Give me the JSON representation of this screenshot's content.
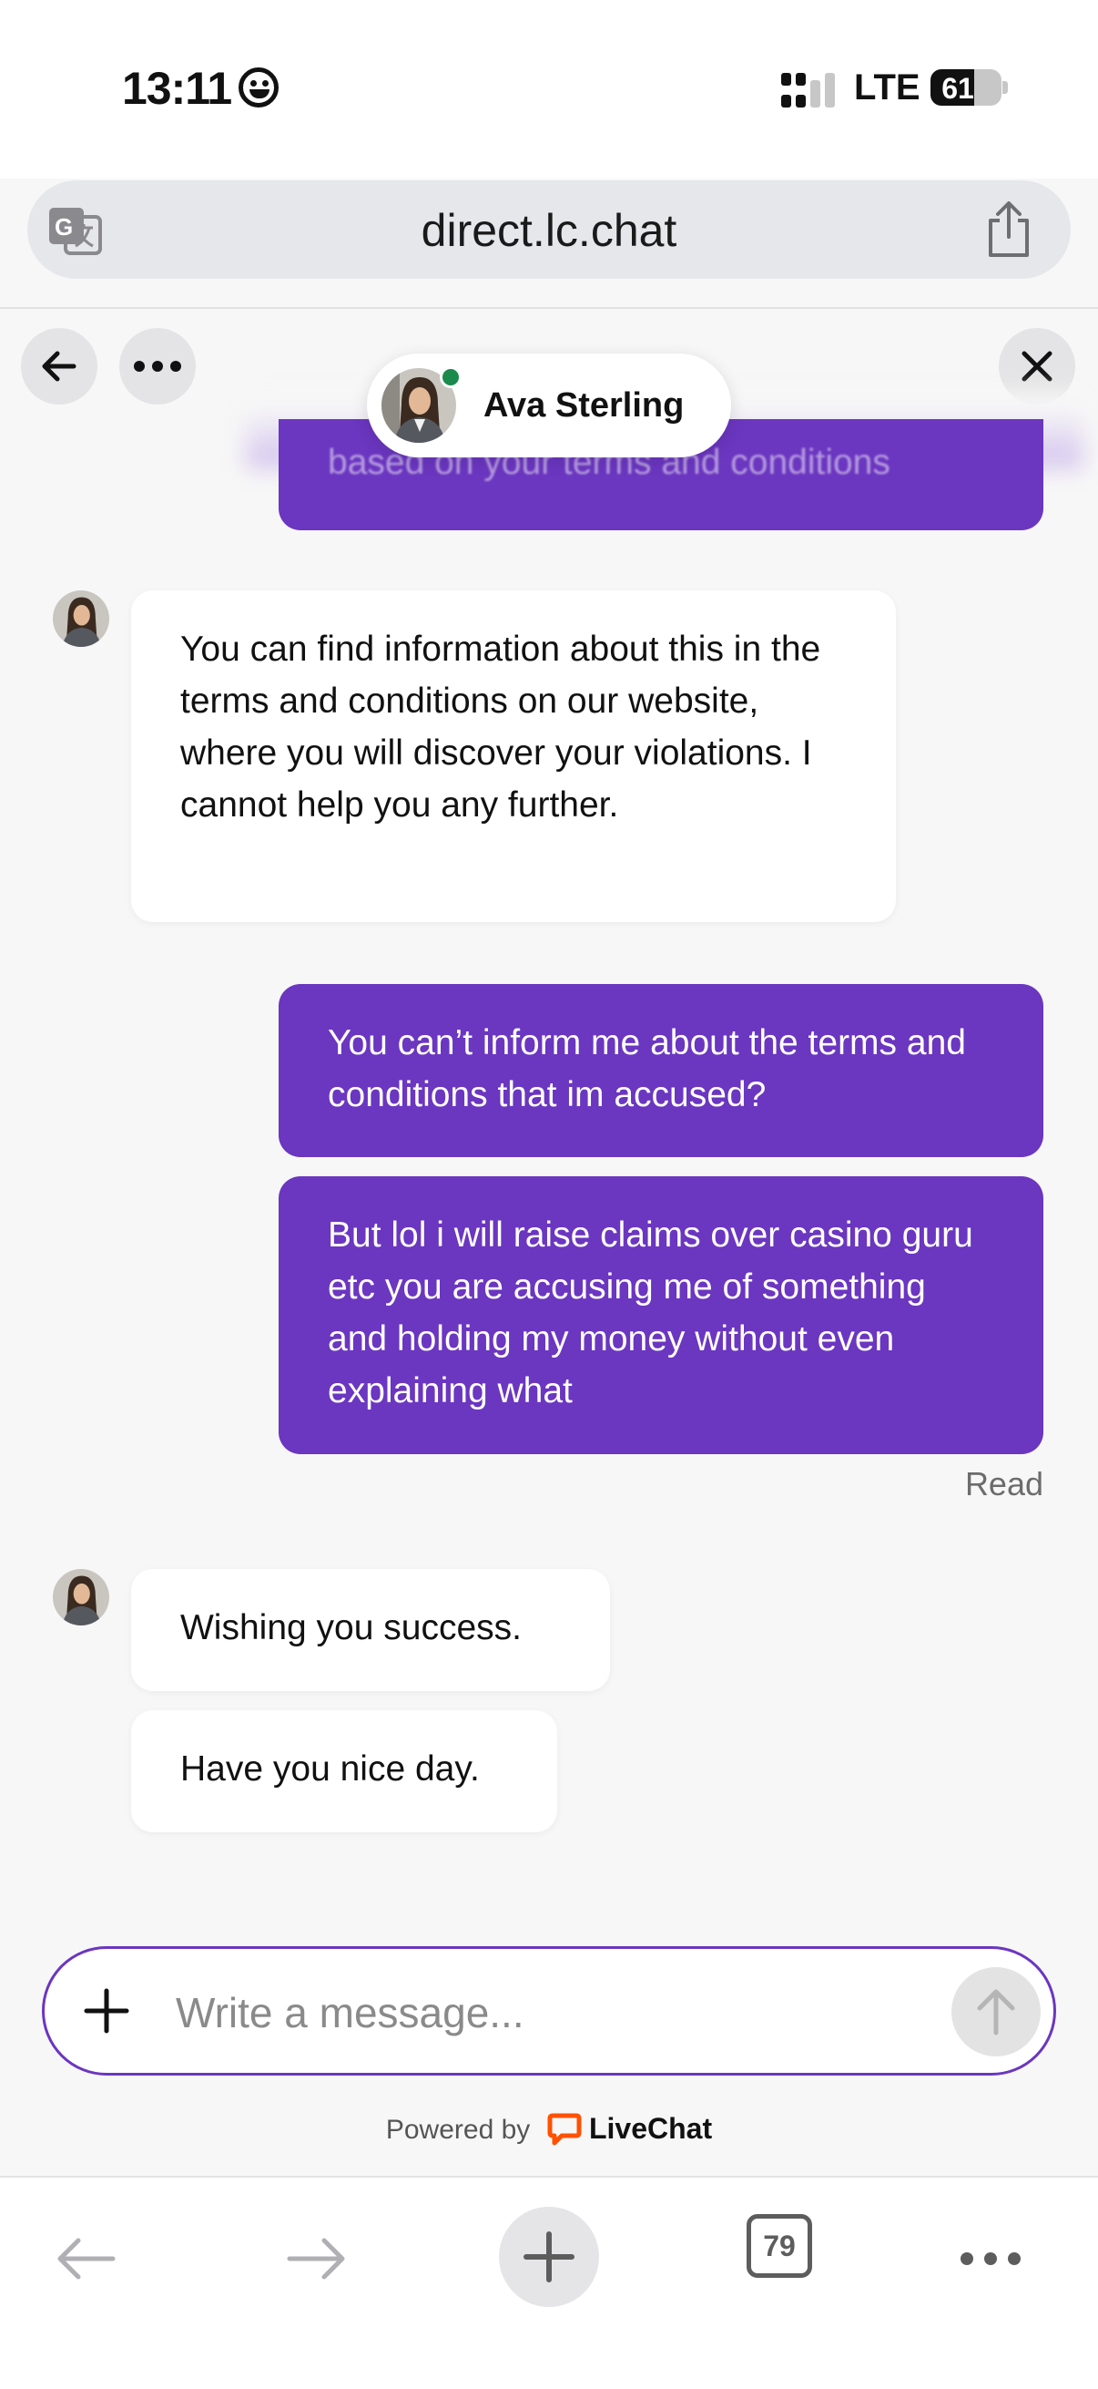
{
  "status_bar": {
    "time": "13:11",
    "network": "LTE",
    "battery": "61",
    "battery_level": 0.61
  },
  "browser": {
    "url": "direct.lc.chat",
    "tab_count": "79"
  },
  "chat": {
    "agent_name": "Ava Sterling",
    "agent_status": "online",
    "faded_message": "based on your terms and conditions",
    "messages": [
      {
        "from": "agent",
        "text": "You can find information about this in the terms and conditions on our website, where you will discover your violations. I cannot help you any further."
      },
      {
        "from": "user",
        "text": "You can’t inform me about the terms and conditions that im accused?"
      },
      {
        "from": "user",
        "text": "But lol i will raise claims over casino guru etc you are accusing me of something and holding my money without even explaining what"
      },
      {
        "from": "agent",
        "text": "Wishing you success."
      },
      {
        "from": "agent",
        "text": "Have you nice day."
      }
    ],
    "read_receipt": "Read",
    "composer_placeholder": "Write a message...",
    "powered_by": "Powered by",
    "brand": "LiveChat"
  },
  "colors": {
    "accent": "#6b36c0",
    "online": "#1b8a4c",
    "brand": "#ff5100"
  }
}
